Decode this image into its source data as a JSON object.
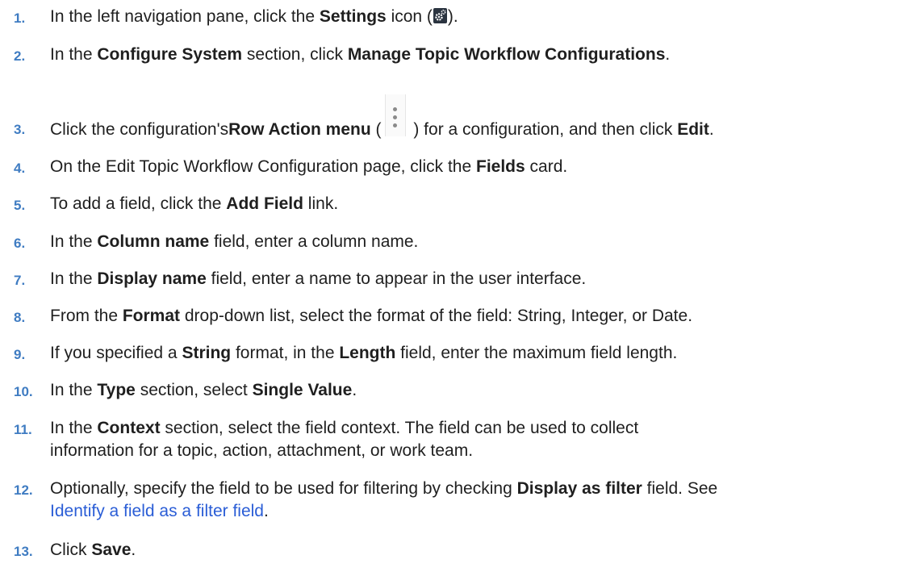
{
  "steps": [
    {
      "num": "1.",
      "t1": "In the left navigation pane, click the ",
      "b1": "Settings",
      "t2": " icon (",
      "t3": ").",
      "icon": "settings-icon"
    },
    {
      "num": "2.",
      "t1": "In the ",
      "b1": "Configure System",
      "t2": " section, click ",
      "b2": "Manage Topic Workflow Configurations",
      "t3": "."
    },
    {
      "num": "3.",
      "t1": "Click the configuration's ",
      "b1": "Row Action menu",
      "t2": " (",
      "t3": " ) for a configuration, and then click ",
      "b2": "Edit",
      "t4": ".",
      "icon": "kebab-menu-icon"
    },
    {
      "num": "4.",
      "t1": "On the Edit Topic Workflow Configuration page, click the ",
      "b1": "Fields",
      "t2": " card."
    },
    {
      "num": "5.",
      "t1": "To add a field, click the ",
      "b1": "Add Field",
      "t2": " link."
    },
    {
      "num": "6.",
      "t1": "In the ",
      "b1": "Column name",
      "t2": " field, enter a column name."
    },
    {
      "num": "7.",
      "t1": "In the ",
      "b1": "Display name",
      "t2": " field, enter a name to appear in the user interface."
    },
    {
      "num": "8.",
      "t1": "From the ",
      "b1": "Format",
      "t2": " drop-down list, select the format of the field: String, Integer, or Date."
    },
    {
      "num": "9.",
      "t1": "If you specified a ",
      "b1": "String",
      "t2": " format, in the ",
      "b2": "Length",
      "t3": " field, enter the maximum field length."
    },
    {
      "num": "10.",
      "t1": "In the ",
      "b1": "Type",
      "t2": " section, select ",
      "b2": "Single Value",
      "t3": "."
    },
    {
      "num": "11.",
      "t1": "In the ",
      "b1": "Context",
      "t2": " section, select the field context. The field can be used to collect",
      "t3": "information for a topic, action, attachment, or work team."
    },
    {
      "num": "12.",
      "t1": "Optionally, specify the field to be used for filtering by checking ",
      "b1": "Display as filter",
      "t2": " field. See",
      "link": "Identify a field as a filter field",
      "t3": "."
    },
    {
      "num": "13.",
      "t1": "Click ",
      "b1": "Save",
      "t2": "."
    }
  ],
  "colors": {
    "step_number": "#3f7cc2",
    "link": "#2a5dd6",
    "text": "#1f1f1f"
  }
}
